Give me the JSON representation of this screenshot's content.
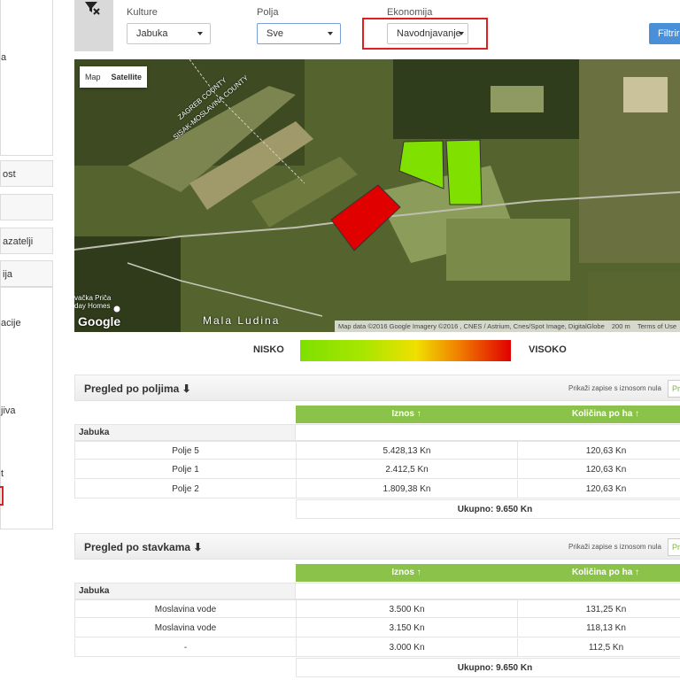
{
  "sidebar": {
    "items": [
      "a",
      "ost",
      "azatelji",
      "ija",
      "acije",
      "jiva",
      "t"
    ]
  },
  "filters": {
    "kulture_label": "Kulture",
    "kulture_value": "Jabuka",
    "polja_label": "Polja",
    "polja_value": "Sve",
    "ekonomija_label": "Ekonomija",
    "ekonomija_value": "Navodnjavanje",
    "filter_button": "Filtrir"
  },
  "map": {
    "type_map": "Map",
    "type_satellite": "Satellite",
    "place_labels": [
      "ZAGREB COUNTY",
      "SISAK-MOSLAVINA COUNTY",
      "vačka Priča",
      "day Homes",
      "Mala Ludina"
    ],
    "google": "Google",
    "attribution": "Map data ©2016 Google Imagery ©2016 , CNES / Astrium, Cnes/Spot Image, DigitalGlobe",
    "scale": "200 m",
    "terms": "Terms of Use",
    "fields": [
      {
        "name": "Polje 1",
        "color": "#7ee000"
      },
      {
        "name": "Polje 2",
        "color": "#7ee000"
      },
      {
        "name": "Polje 5",
        "color": "#e00000"
      }
    ]
  },
  "legend": {
    "low": "NISKO",
    "high": "VISOKO",
    "colors": [
      "#7ee000",
      "#f0e000",
      "#e00000"
    ]
  },
  "table1": {
    "title": "Pregled po poljima ⬇",
    "note": "Prikaži zapise s iznosom nula",
    "checkbox_label": "Pr",
    "col_iznos": "Iznos ↑",
    "col_kolicina": "Količina po ha ↑",
    "group": "Jabuka",
    "rows": [
      {
        "name": "Polje 5",
        "iznos": "5.428,13 Kn",
        "kolicina": "120,63 Kn"
      },
      {
        "name": "Polje 1",
        "iznos": "2.412,5 Kn",
        "kolicina": "120,63 Kn"
      },
      {
        "name": "Polje 2",
        "iznos": "1.809,38 Kn",
        "kolicina": "120,63 Kn"
      }
    ],
    "total": "Ukupno: 9.650 Kn"
  },
  "table2": {
    "title": "Pregled po stavkama ⬇",
    "note": "Prikaži zapise s iznosom nula",
    "checkbox_label": "Pr",
    "col_iznos": "Iznos ↑",
    "col_kolicina": "Količina po ha ↑",
    "group": "Jabuka",
    "rows": [
      {
        "name": "Moslavina vode",
        "iznos": "3.500 Kn",
        "kolicina": "131,25 Kn"
      },
      {
        "name": "Moslavina vode",
        "iznos": "3.150 Kn",
        "kolicina": "118,13 Kn"
      },
      {
        "name": "-",
        "iznos": "3.000 Kn",
        "kolicina": "112,5 Kn"
      }
    ],
    "total": "Ukupno: 9.650  Kn"
  }
}
